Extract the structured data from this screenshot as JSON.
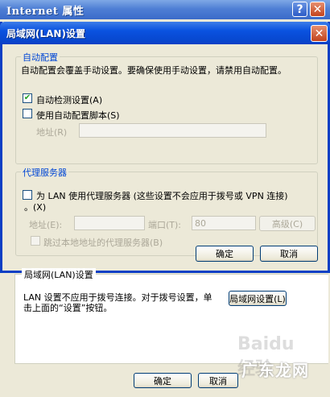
{
  "parent_window": {
    "title": "Internet 属性",
    "help_glyph": "?",
    "close_glyph": "✕",
    "lan_group": {
      "title": "局域网(LAN)设置",
      "text": "LAN 设置不应用于拨号连接。对于拨号设置，单击上面的“设置”按钮。",
      "lan_settings_button": "局域网设置(L)"
    },
    "bottom_buttons": {
      "ok": "确定",
      "cancel": "取消"
    }
  },
  "lan_dialog": {
    "title": "局域网(LAN)设置",
    "close_glyph": "✕",
    "auto_config": {
      "title": "自动配置",
      "description": "自动配置会覆盖手动设置。要确保使用手动设置，请禁用自动配置。",
      "auto_detect": {
        "label": "自动检测设置(A)",
        "checked": "✔"
      },
      "use_script": {
        "label": "使用自动配置脚本(S)"
      },
      "address_label": "地址(R)"
    },
    "proxy": {
      "title": "代理服务器",
      "use_proxy_line1": "为 LAN 使用代理服务器 (这些设置不会应用于拨号或 VPN 连接)",
      "use_proxy_line2": "。(X)",
      "address_label": "地址(E):",
      "port_label": "端口(T):",
      "port_value": "80",
      "advanced_button": "高级(C)",
      "bypass_label": "跳过本地地址的代理服务器(B)"
    },
    "buttons": {
      "ok": "确定",
      "cancel": "取消"
    }
  },
  "watermark": {
    "text": "广东龙网",
    "brand": "Baidu 经验"
  }
}
